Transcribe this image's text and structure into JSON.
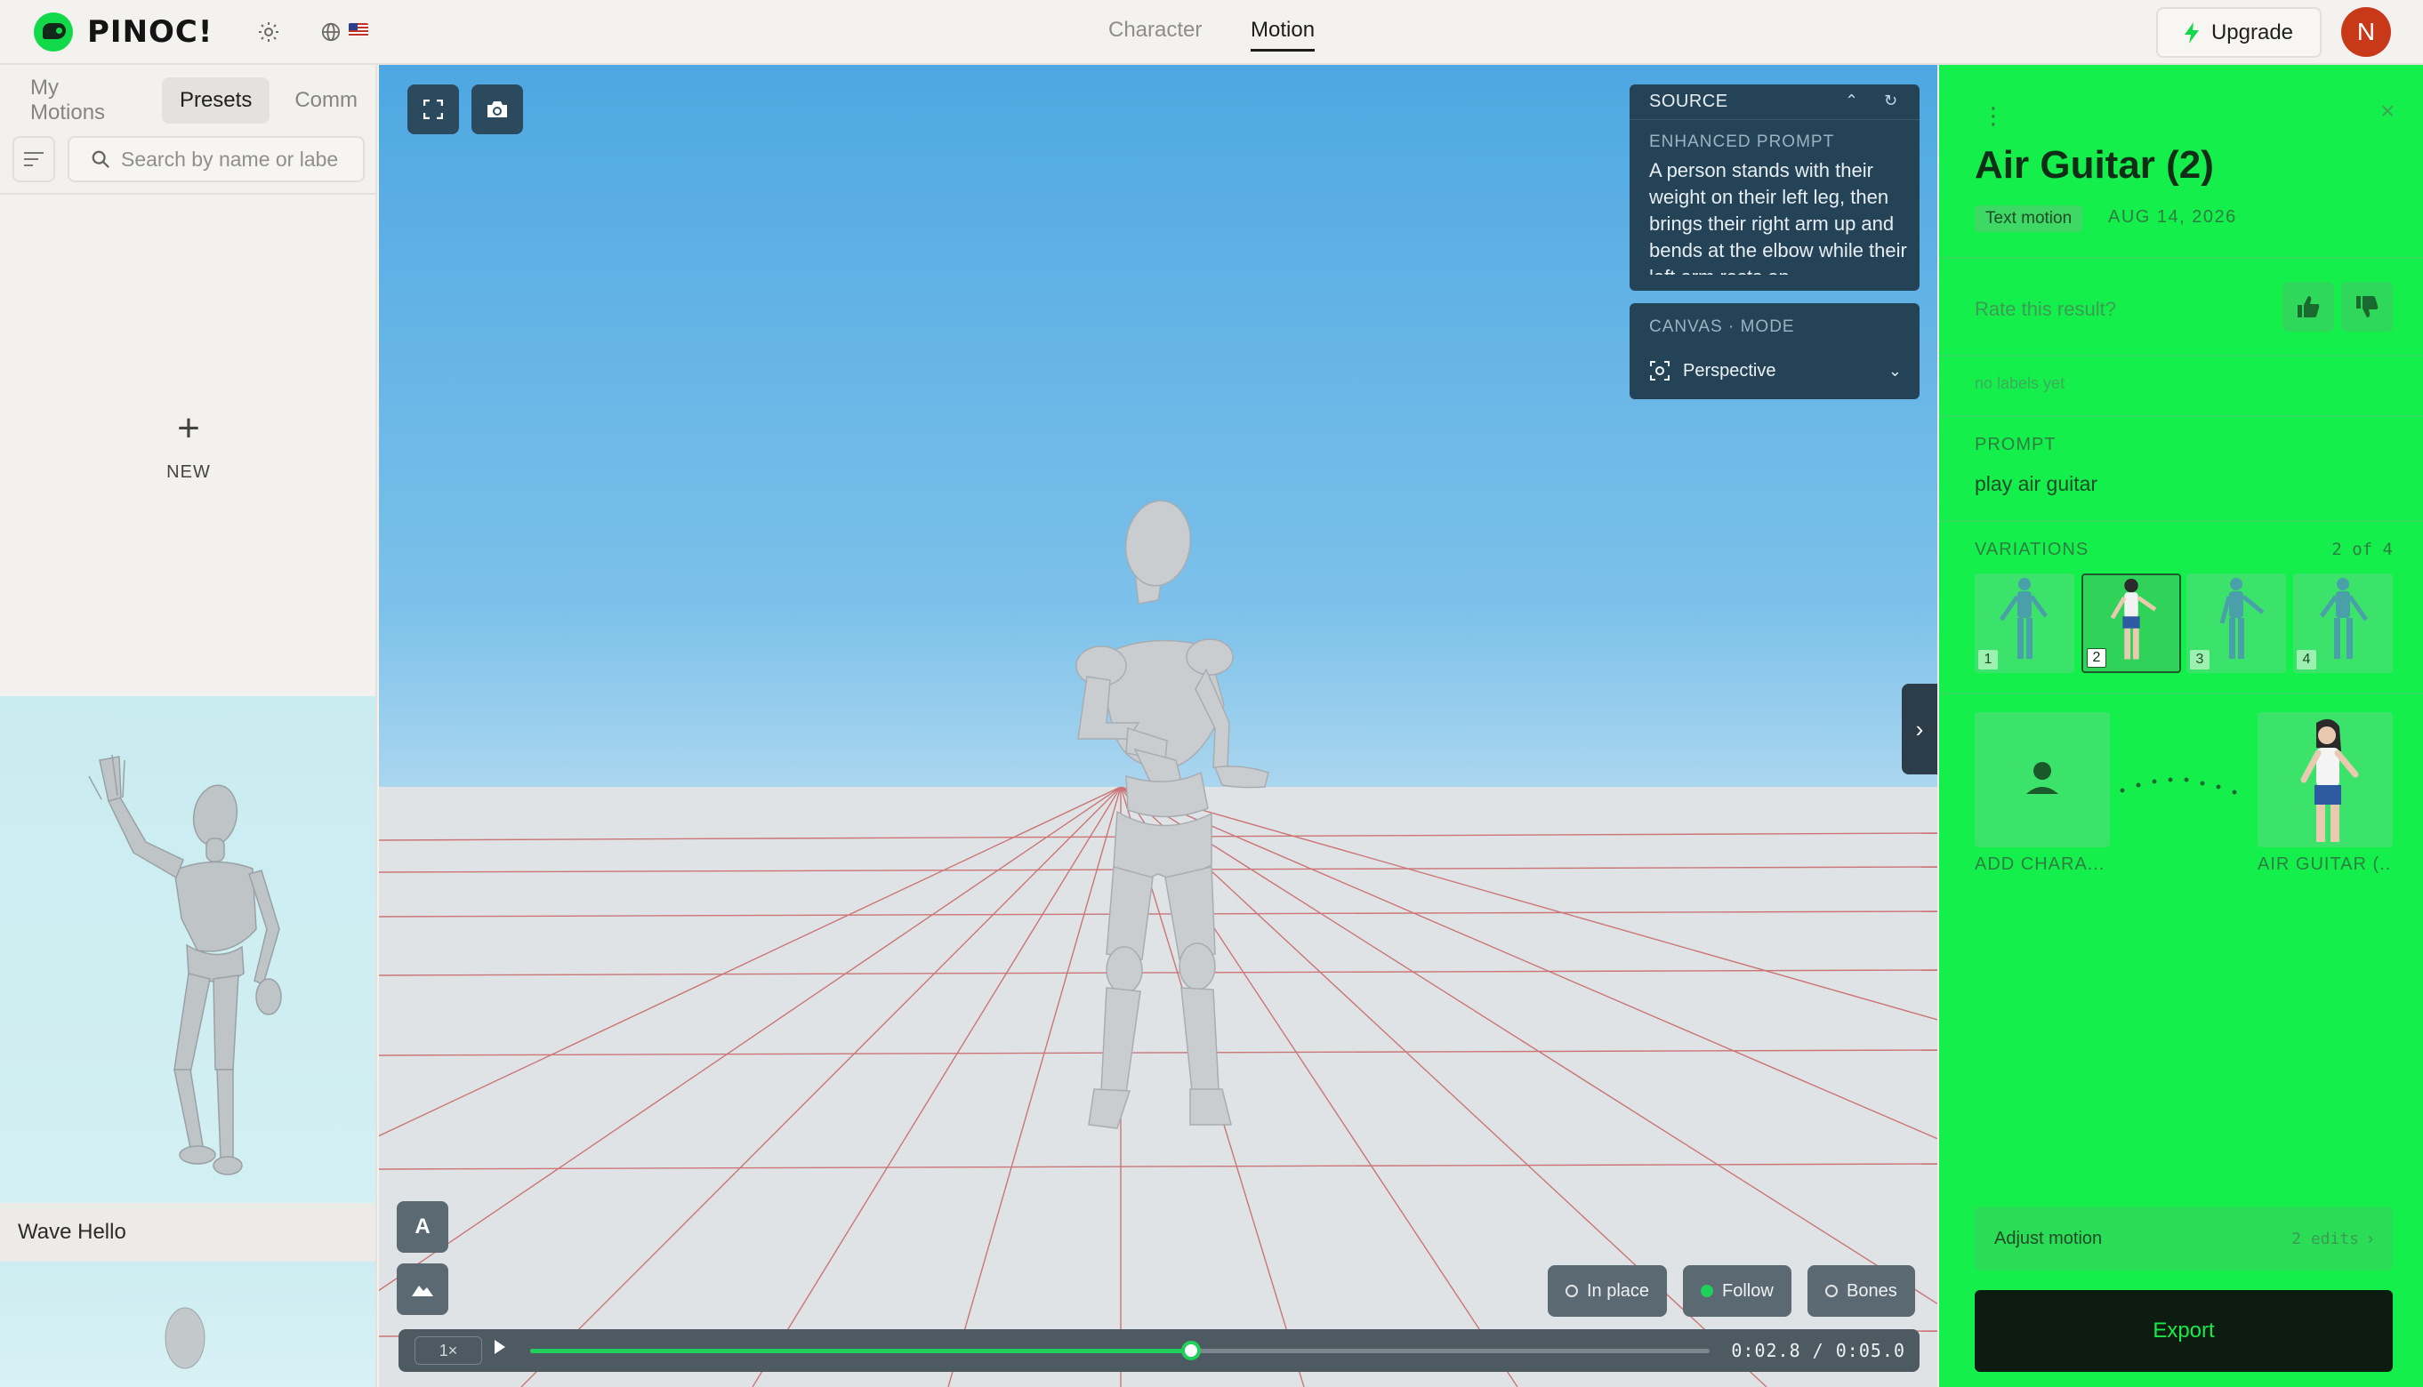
{
  "app": {
    "name": "PINOC!"
  },
  "header": {
    "tabs": [
      {
        "label": "Character"
      },
      {
        "label": "Motion"
      }
    ],
    "active_tab": "Motion",
    "upgrade_label": "Upgrade",
    "avatar_initial": "N"
  },
  "library": {
    "tabs": [
      {
        "label": "My Motions"
      },
      {
        "label": "Presets"
      },
      {
        "label": "Comm"
      }
    ],
    "active_tab": "Presets",
    "search_placeholder": "Search by name or labe",
    "new_label": "NEW",
    "presets": [
      {
        "label": "Wave Hello"
      }
    ]
  },
  "viewport": {
    "source": {
      "title": "SOURCE",
      "enhanced_label": "ENHANCED PROMPT",
      "enhanced_text": "A person stands with their weight on their left leg, then brings their right arm up and bends at the elbow while their left arm rests on"
    },
    "canvas": {
      "title": "CANVAS · MODE",
      "mode": "Perspective"
    },
    "overlay_letter": "A",
    "toggles": [
      {
        "label": "In place",
        "on": false
      },
      {
        "label": "Follow",
        "on": true
      },
      {
        "label": "Bones",
        "on": false
      }
    ],
    "timeline": {
      "speed": "1×",
      "current": "0:02.8",
      "separator": "/",
      "total": "0:05.0",
      "progress": 0.56
    }
  },
  "detail": {
    "title": "Air Guitar (2)",
    "badge": "Text motion",
    "date": "AUG 14, 2026",
    "rate_prompt": "Rate this result?",
    "no_labels": "no labels yet",
    "prompt_label": "PROMPT",
    "prompt_text": "play air guitar",
    "variations_label": "VARIATIONS",
    "variations_count": "2 of 4",
    "variations": [
      {
        "num": "1"
      },
      {
        "num": "2"
      },
      {
        "num": "3"
      },
      {
        "num": "4"
      }
    ],
    "selected_variation": 2,
    "add_character_label": "ADD CHARA...",
    "result_label": "AIR GUITAR (...",
    "adjust_label": "Adjust motion",
    "adjust_edits": "2 edits",
    "export_label": "Export"
  },
  "colors": {
    "accent_green": "#14ef4c",
    "export_bg": "#0c1c10",
    "avatar": "#c8391a",
    "panel_navy": "#254357"
  }
}
